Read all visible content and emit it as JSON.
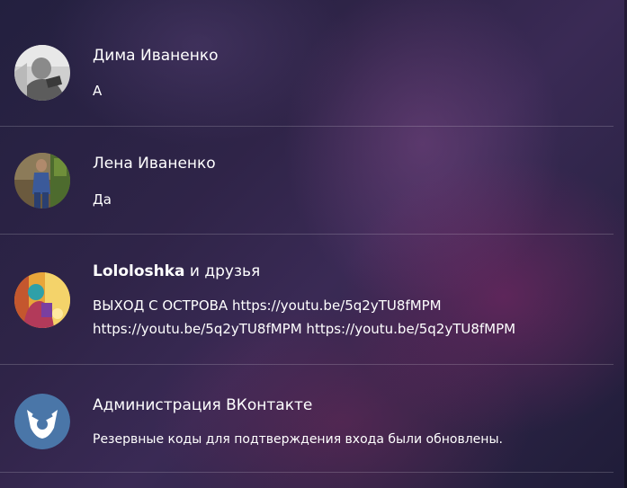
{
  "conversations": [
    {
      "name": "Дима Иваненко",
      "name_bold": "",
      "name_rest": "",
      "message": "А"
    },
    {
      "name": "Лена Иваненко",
      "name_bold": "",
      "name_rest": "",
      "message": "Да"
    },
    {
      "name": "",
      "name_bold": "Lololoshka",
      "name_rest": " и друзья",
      "message": "ВЫХОД С ОСТРОВА https://youtu.be/5q2yTU8fMPM https://youtu.be/5q2yTU8fMPM https://youtu.be/5q2yTU8fMPM"
    },
    {
      "name": "Администрация ВКонтакте",
      "name_bold": "",
      "name_rest": "",
      "message": "Резервные коды для подтверждения входа были обновлены."
    }
  ],
  "avatars": {
    "vk_logo_color": "#4a76a8"
  }
}
